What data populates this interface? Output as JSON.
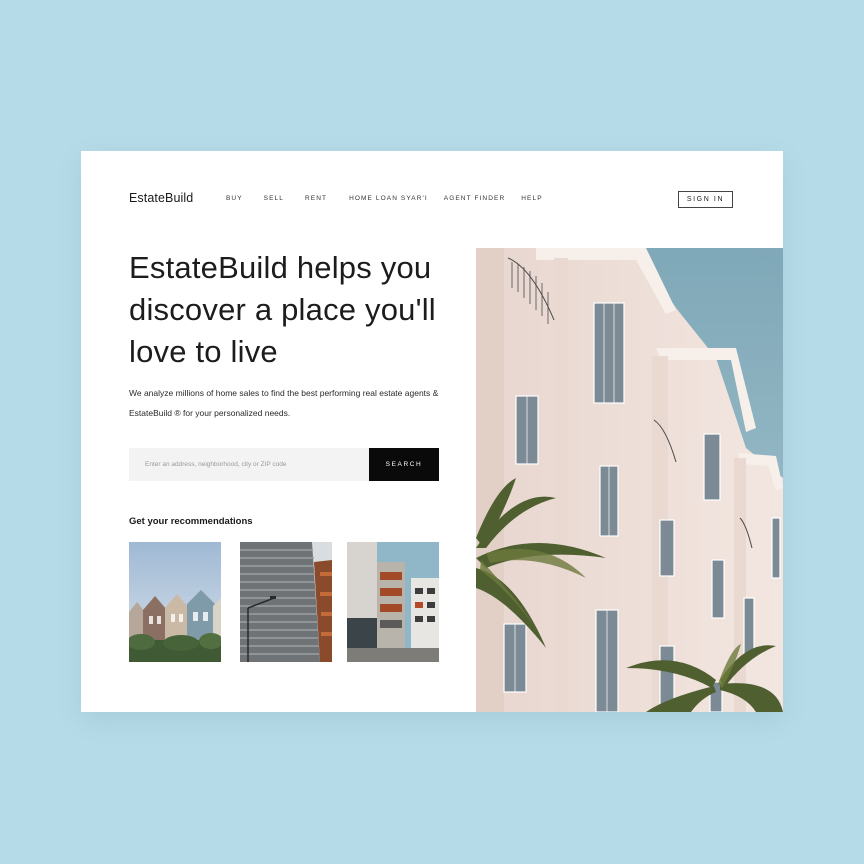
{
  "header": {
    "logo": "EstateBuild",
    "nav": [
      "BUY",
      "SELL",
      "RENT",
      "HOME LOAN SYAR'I",
      "AGENT FINDER",
      "HELP"
    ],
    "sign_in": "SIGN IN"
  },
  "hero": {
    "headline": "EstateBuild helps you discover a place you'll love to live",
    "subtitle": "We analyze millions of home sales to find the best performing real estate agents & EstateBuild ® for your personalized needs."
  },
  "search": {
    "placeholder": "Enter an address, neighborhood, city or ZIP code",
    "button": "SEARCH"
  },
  "recommendations": {
    "title": "Get your recommendations"
  },
  "colors": {
    "background": "#b6dbe8",
    "card": "#ffffff",
    "button": "#0a0a0a",
    "input": "#f3f3f3"
  }
}
